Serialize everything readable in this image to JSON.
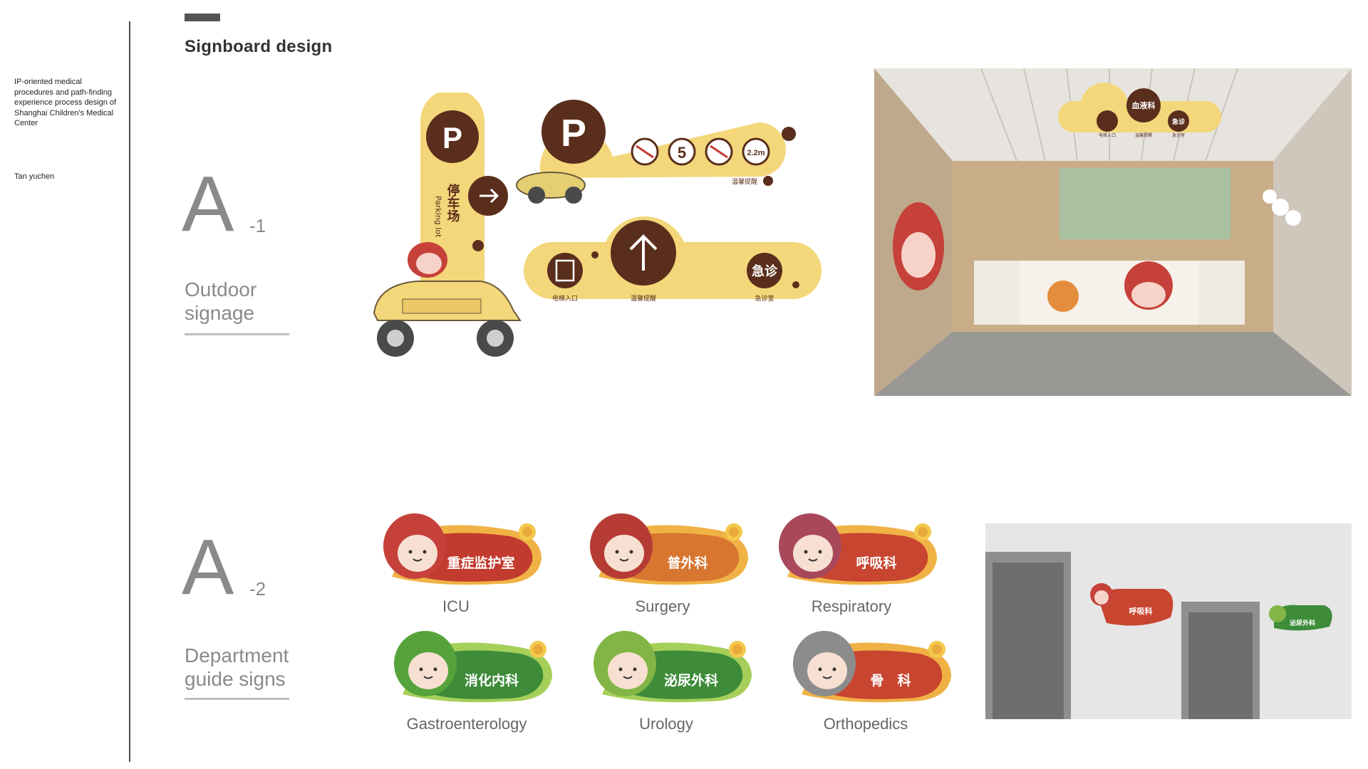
{
  "sidebar": {
    "description": "IP-oriented medical procedures and path-finding experience process design of Shanghai Children's Medical Center",
    "author": "Tan yuchen"
  },
  "page_title": "Signboard design",
  "sections": [
    {
      "letter": "A",
      "number": "-1",
      "label_line1": "Outdoor",
      "label_line2": "signage"
    },
    {
      "letter": "A",
      "number": "-2",
      "label_line1": "Department",
      "label_line2": "guide signs"
    }
  ],
  "parking": {
    "p_letter": "P",
    "vertical_cn": "停车场",
    "vertical_en": "Parking lot",
    "speed_limit": "5",
    "height_limit": "2.2m",
    "notice": "温馨提醒"
  },
  "direction_sign": {
    "elevator_label": "电梯入口",
    "notice": "温馨提醒",
    "emergency": "急诊",
    "emergency_room": "急诊室"
  },
  "hanging_sign": {
    "center": "血液科",
    "right": "急诊",
    "left_small": "电梯入口",
    "center_small": "温馨提醒",
    "right_small": "急诊室"
  },
  "departments": [
    {
      "cn": "重症监护室",
      "en": "ICU",
      "color": "#c23b2e",
      "char": "#c5413a"
    },
    {
      "cn": "普外科",
      "en": "Surgery",
      "color": "#d8762f",
      "char": "#b63b35"
    },
    {
      "cn": "呼吸科",
      "en": "Respiratory",
      "color": "#c8452f",
      "char": "#a8485a"
    },
    {
      "cn": "消化内科",
      "en": "Gastroenterology",
      "color": "#3e8c3a",
      "char": "#56a33b"
    },
    {
      "cn": "泌尿外科",
      "en": "Urology",
      "color": "#3e8c3a",
      "char": "#82b545"
    },
    {
      "cn": "骨　科",
      "en": "Orthopedics",
      "color": "#c8452f",
      "char": "#8c8c8c"
    }
  ],
  "wall_photo": {
    "sign1": "呼吸科",
    "sign2": "泌尿外科"
  },
  "colors": {
    "brown": "#5a2e1c",
    "yellow": "#f3d77a",
    "gray_text": "#8a8a8a"
  }
}
